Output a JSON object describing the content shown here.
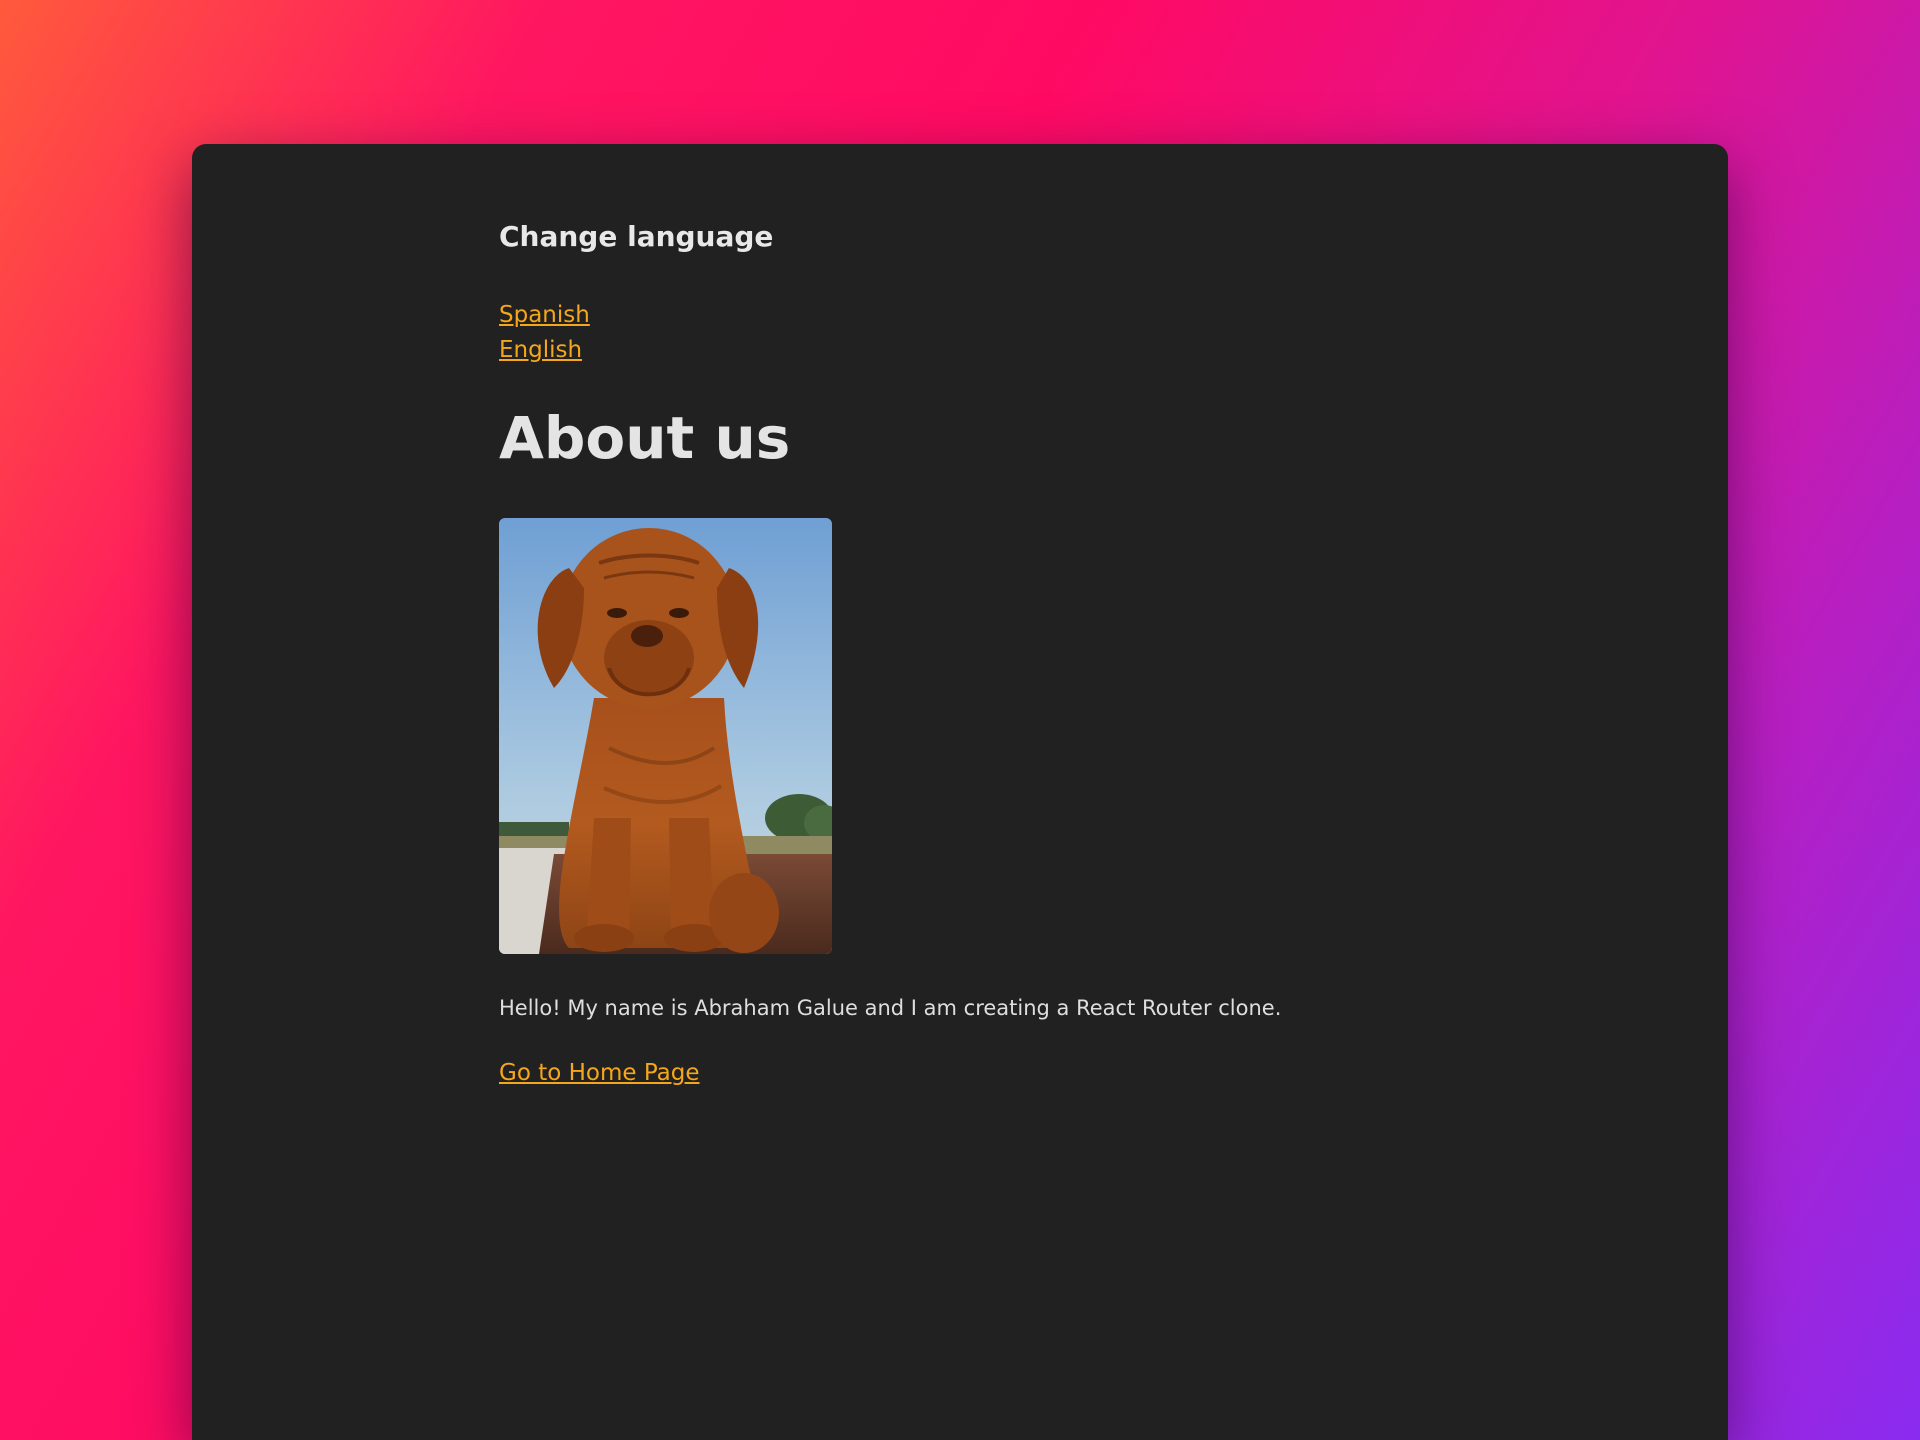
{
  "language_section": {
    "title": "Change language",
    "links": [
      "Spanish",
      "English"
    ]
  },
  "main": {
    "title": "About us",
    "photo": {
      "subject": "dog-photo"
    },
    "bio": "Hello! My name is Abraham Galue and I am creating a React Router clone.",
    "home_link": "Go to Home Page"
  },
  "colors": {
    "background_gradient": [
      "#ff5a3c",
      "#ff1661",
      "#e01490",
      "#8a2bf0"
    ],
    "card": "#212121",
    "text": "#e6e6e6",
    "link": "#f4a61c"
  }
}
